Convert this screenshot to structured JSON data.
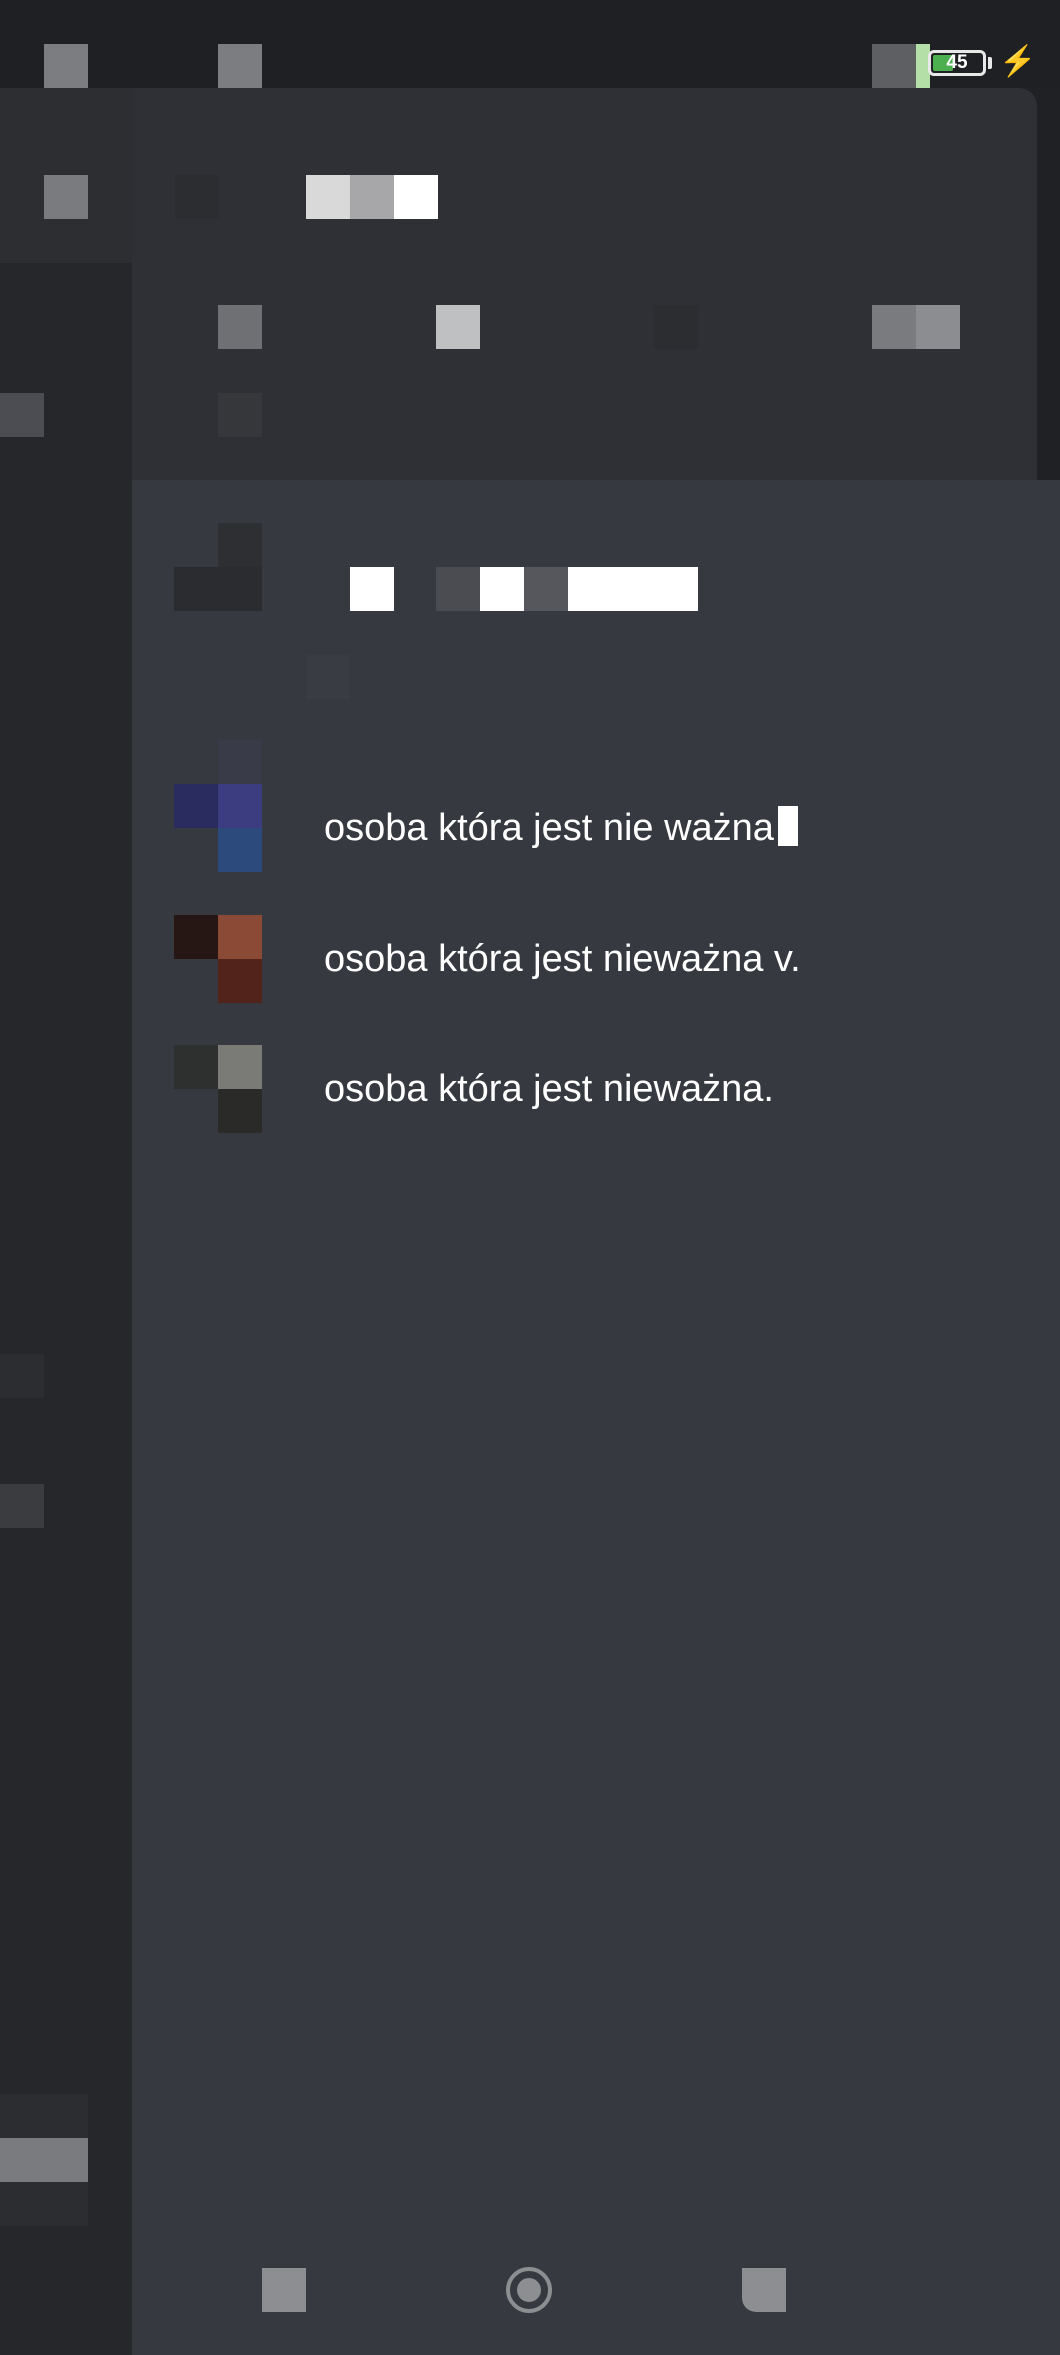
{
  "status_bar": {
    "battery_level": "45",
    "charging_icon": "bolt-icon"
  },
  "members": [
    {
      "name": "osoba która jest nie ważna",
      "has_cursor": true,
      "avatar_colors": [
        "#2a2c60",
        "#3b3d80",
        "#2d4a7c"
      ]
    },
    {
      "name": "osoba która jest nieważna v.",
      "has_cursor": false,
      "avatar_colors": [
        "#261715",
        "#8a4a35",
        "#52231a"
      ]
    },
    {
      "name": "osoba która jest nieważna.",
      "has_cursor": false,
      "avatar_colors": [
        "#2d302f",
        "#7a7b76",
        "#2a2b28"
      ]
    }
  ],
  "navigation_bar": {
    "recents_icon": "recents-square-icon",
    "home_icon": "home-circle-icon",
    "back_icon": "back-icon"
  },
  "colors": {
    "drawer_background": "#36393f",
    "header_background": "#2f3035",
    "rail_background": "#26272b",
    "status_bar_background": "#1f2023"
  }
}
